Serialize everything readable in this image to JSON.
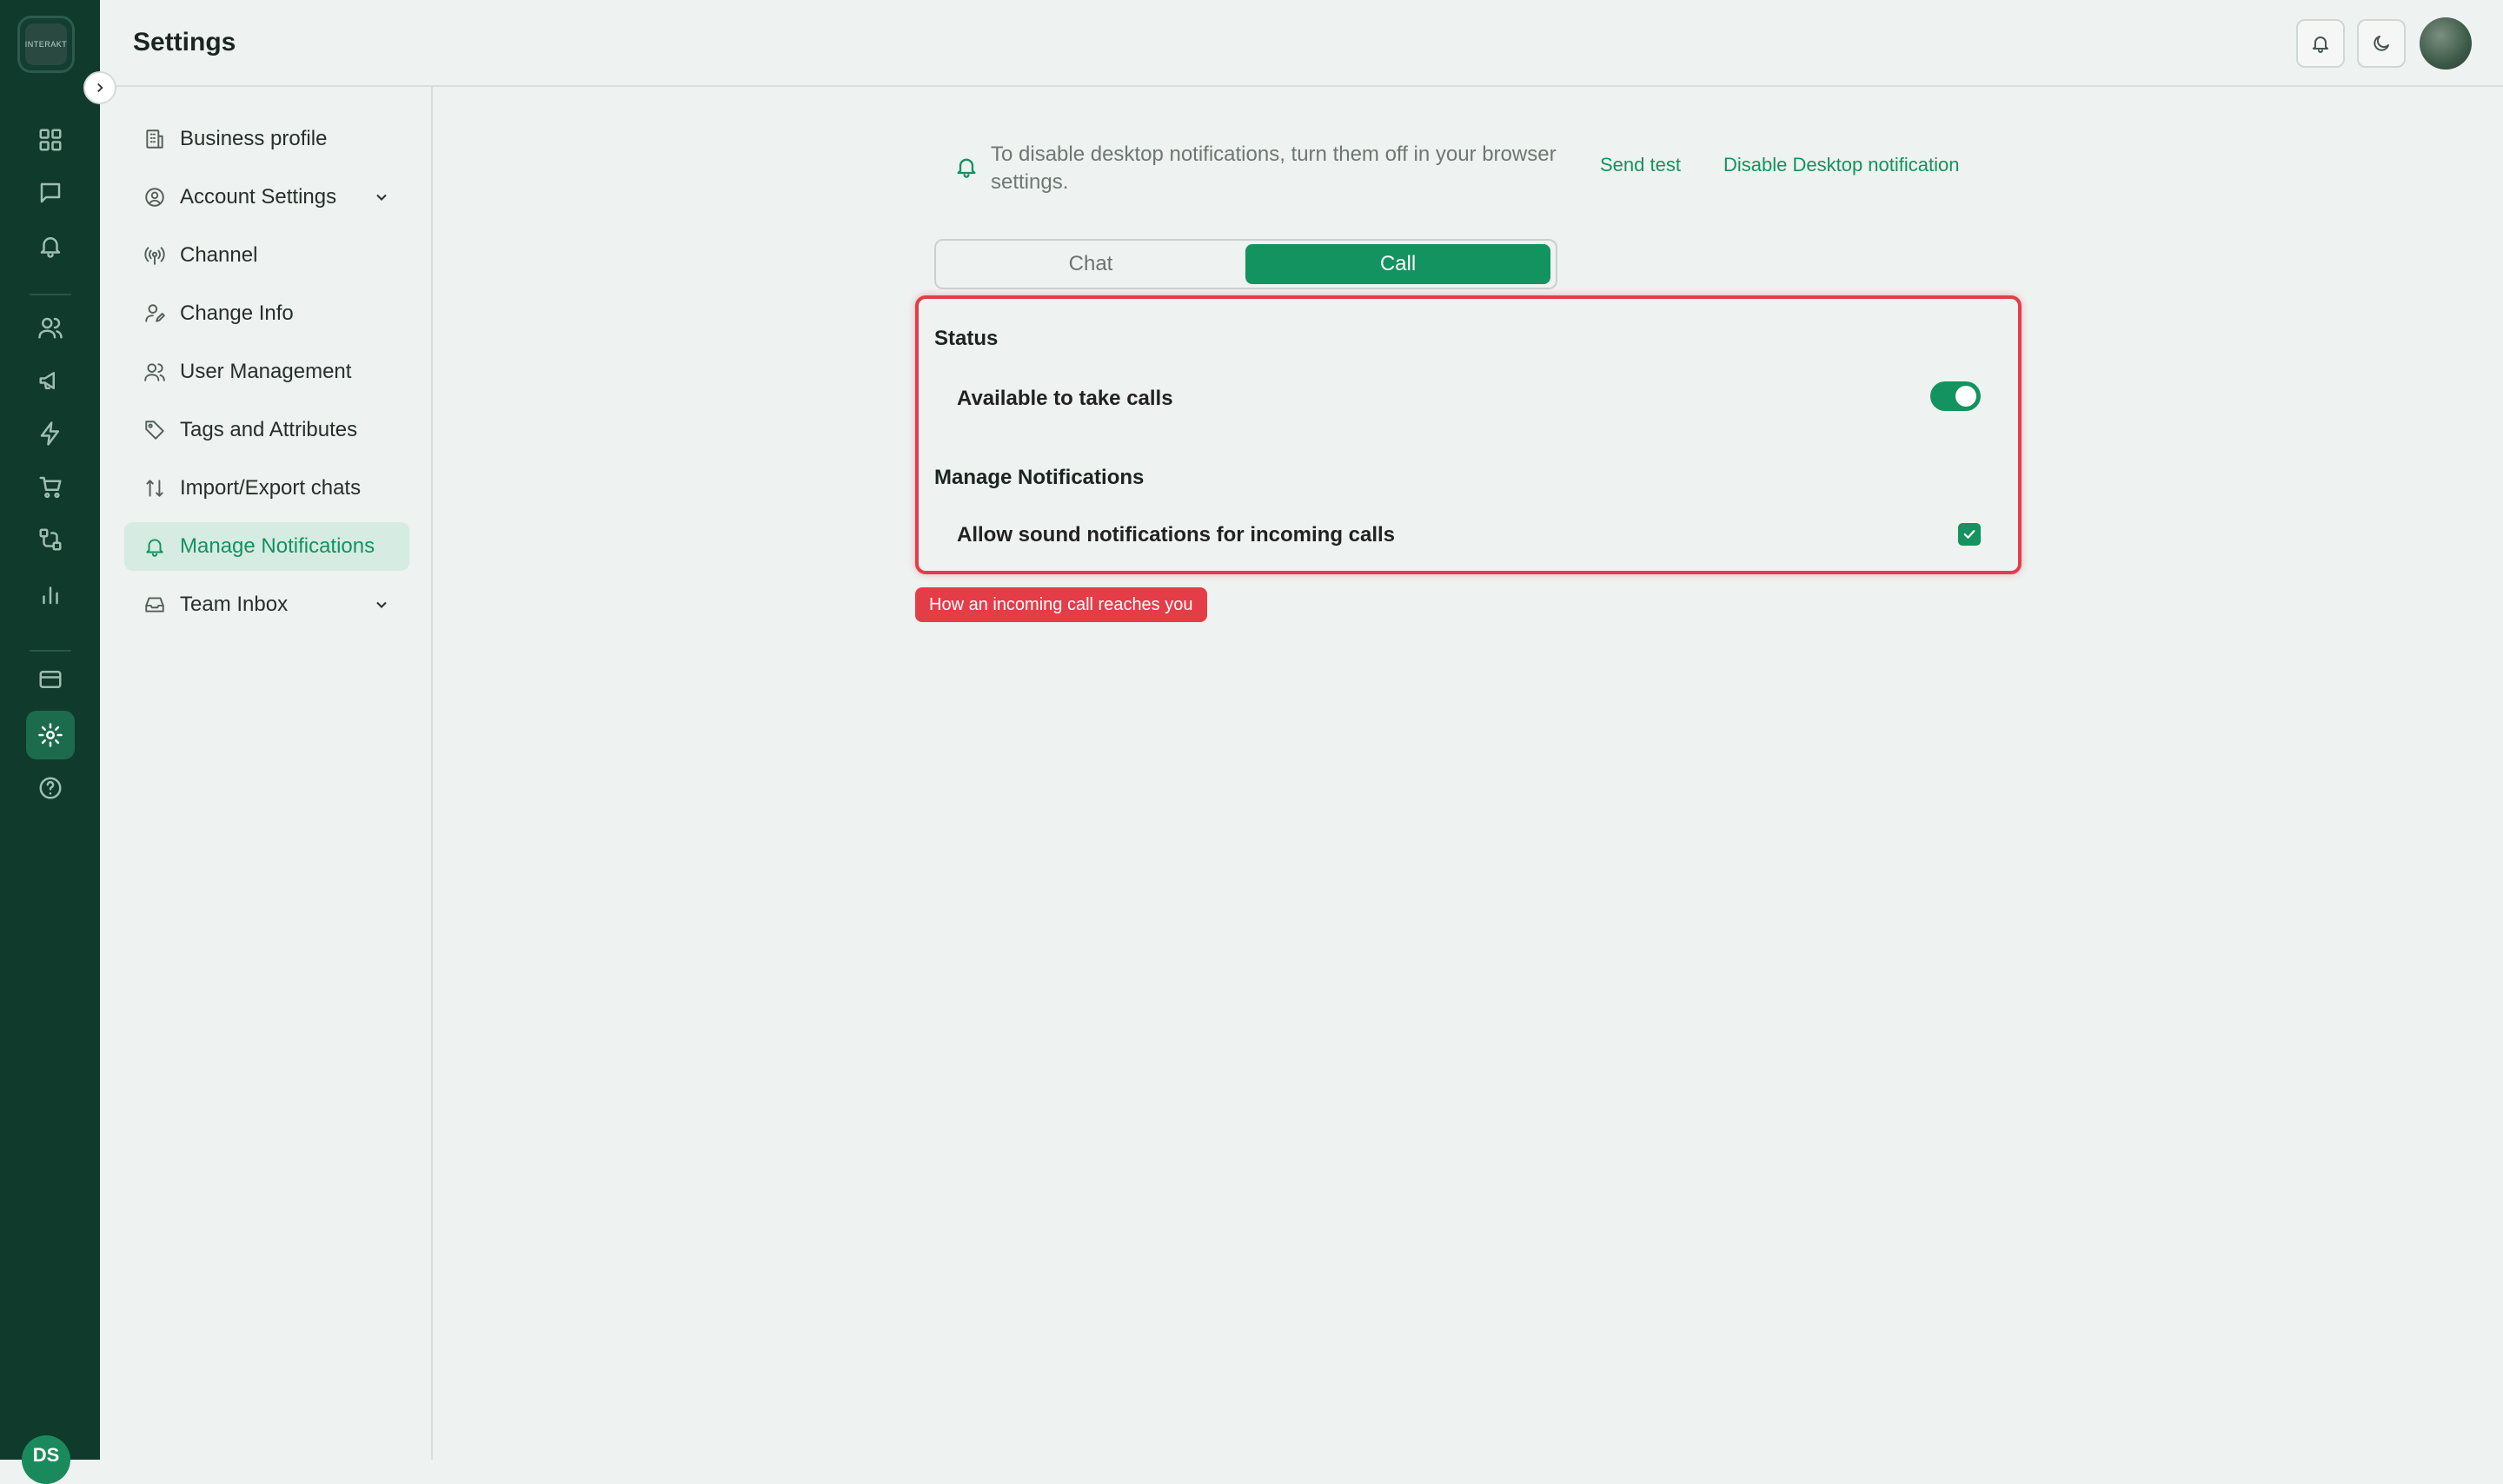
{
  "brand": {
    "logo_text": "INTERAKT",
    "user_initials": "DS"
  },
  "header": {
    "title": "Settings"
  },
  "rail": {
    "items": [
      "dashboard-icon",
      "chat-icon",
      "bell-icon",
      "users-icon",
      "megaphone-icon",
      "lightning-icon",
      "cart-icon",
      "flow-icon",
      "bar-chart-icon",
      "card-icon",
      "gear-icon",
      "help-icon"
    ],
    "active": "gear-icon"
  },
  "settings_nav": {
    "items": [
      {
        "label": "Business profile",
        "icon": "building-icon"
      },
      {
        "label": "Account Settings",
        "icon": "user-circle-icon",
        "expandable": true
      },
      {
        "label": "Channel",
        "icon": "broadcast-icon"
      },
      {
        "label": "Change Info",
        "icon": "user-edit-icon"
      },
      {
        "label": "User Management",
        "icon": "users-icon"
      },
      {
        "label": "Tags and Attributes",
        "icon": "tag-icon"
      },
      {
        "label": "Import/Export chats",
        "icon": "arrows-updown-icon"
      },
      {
        "label": "Manage Notifications",
        "icon": "bell-icon",
        "active": true
      },
      {
        "label": "Team Inbox",
        "icon": "inbox-icon",
        "expandable": true
      }
    ]
  },
  "main": {
    "info_text": "To disable desktop notifications, turn them off in your browser settings.",
    "send_test": "Send test",
    "disable_desktop": "Disable Desktop notification",
    "tabs": [
      {
        "label": "Chat",
        "active": false
      },
      {
        "label": "Call",
        "active": true
      }
    ],
    "status": {
      "title": "Status",
      "available_label": "Available to take calls",
      "available_on": true
    },
    "notifications": {
      "title": "Manage Notifications",
      "sound_label": "Allow sound notifications for incoming calls",
      "sound_checked": true
    },
    "annotation": "How an incoming call reaches you"
  },
  "colors": {
    "accent": "#12935f",
    "rail": "#0f3a2c",
    "highlight": "#e53d48"
  }
}
